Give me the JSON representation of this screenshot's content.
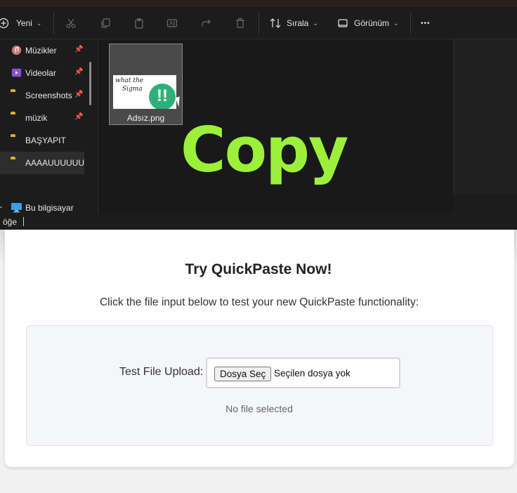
{
  "explorer": {
    "toolbar": {
      "new_label": "Yeni",
      "sort_label": "Sırala",
      "view_label": "Görünüm",
      "more_label": "•••"
    },
    "sidebar": {
      "items": [
        {
          "label": "Müzikler",
          "icon": "music-icon",
          "pinned": true
        },
        {
          "label": "Videolar",
          "icon": "video-icon",
          "pinned": true
        },
        {
          "label": "Screenshots",
          "icon": "folder-icon",
          "pinned": true
        },
        {
          "label": "müzik",
          "icon": "folder-icon",
          "pinned": true
        },
        {
          "label": "BAŞYAPIT",
          "icon": "folder-icon",
          "pinned": false
        },
        {
          "label": "AAAAUUUUUUUU",
          "icon": "folder-icon",
          "pinned": false
        }
      ],
      "this_pc_label": "Bu bilgisayar"
    },
    "file": {
      "name": "Adsız.png",
      "thumb_text_line1": "what the",
      "thumb_text_line2": "Sigma",
      "badge_text": "!!"
    },
    "overlay_text": "Copy",
    "status_text": "öğe"
  },
  "web": {
    "title": "Try QuickPaste Now!",
    "description": "Click the file input below to test your new QuickPaste functionality:",
    "upload_label": "Test File Upload:",
    "choose_button": "Dosya Seç",
    "no_file_inline": "Seçilen dosya yok",
    "status": "No file selected"
  },
  "colors": {
    "overlay_green": "#9cf03a",
    "badge_green": "#2fb07a",
    "folder_yellow": "#f0c040"
  }
}
